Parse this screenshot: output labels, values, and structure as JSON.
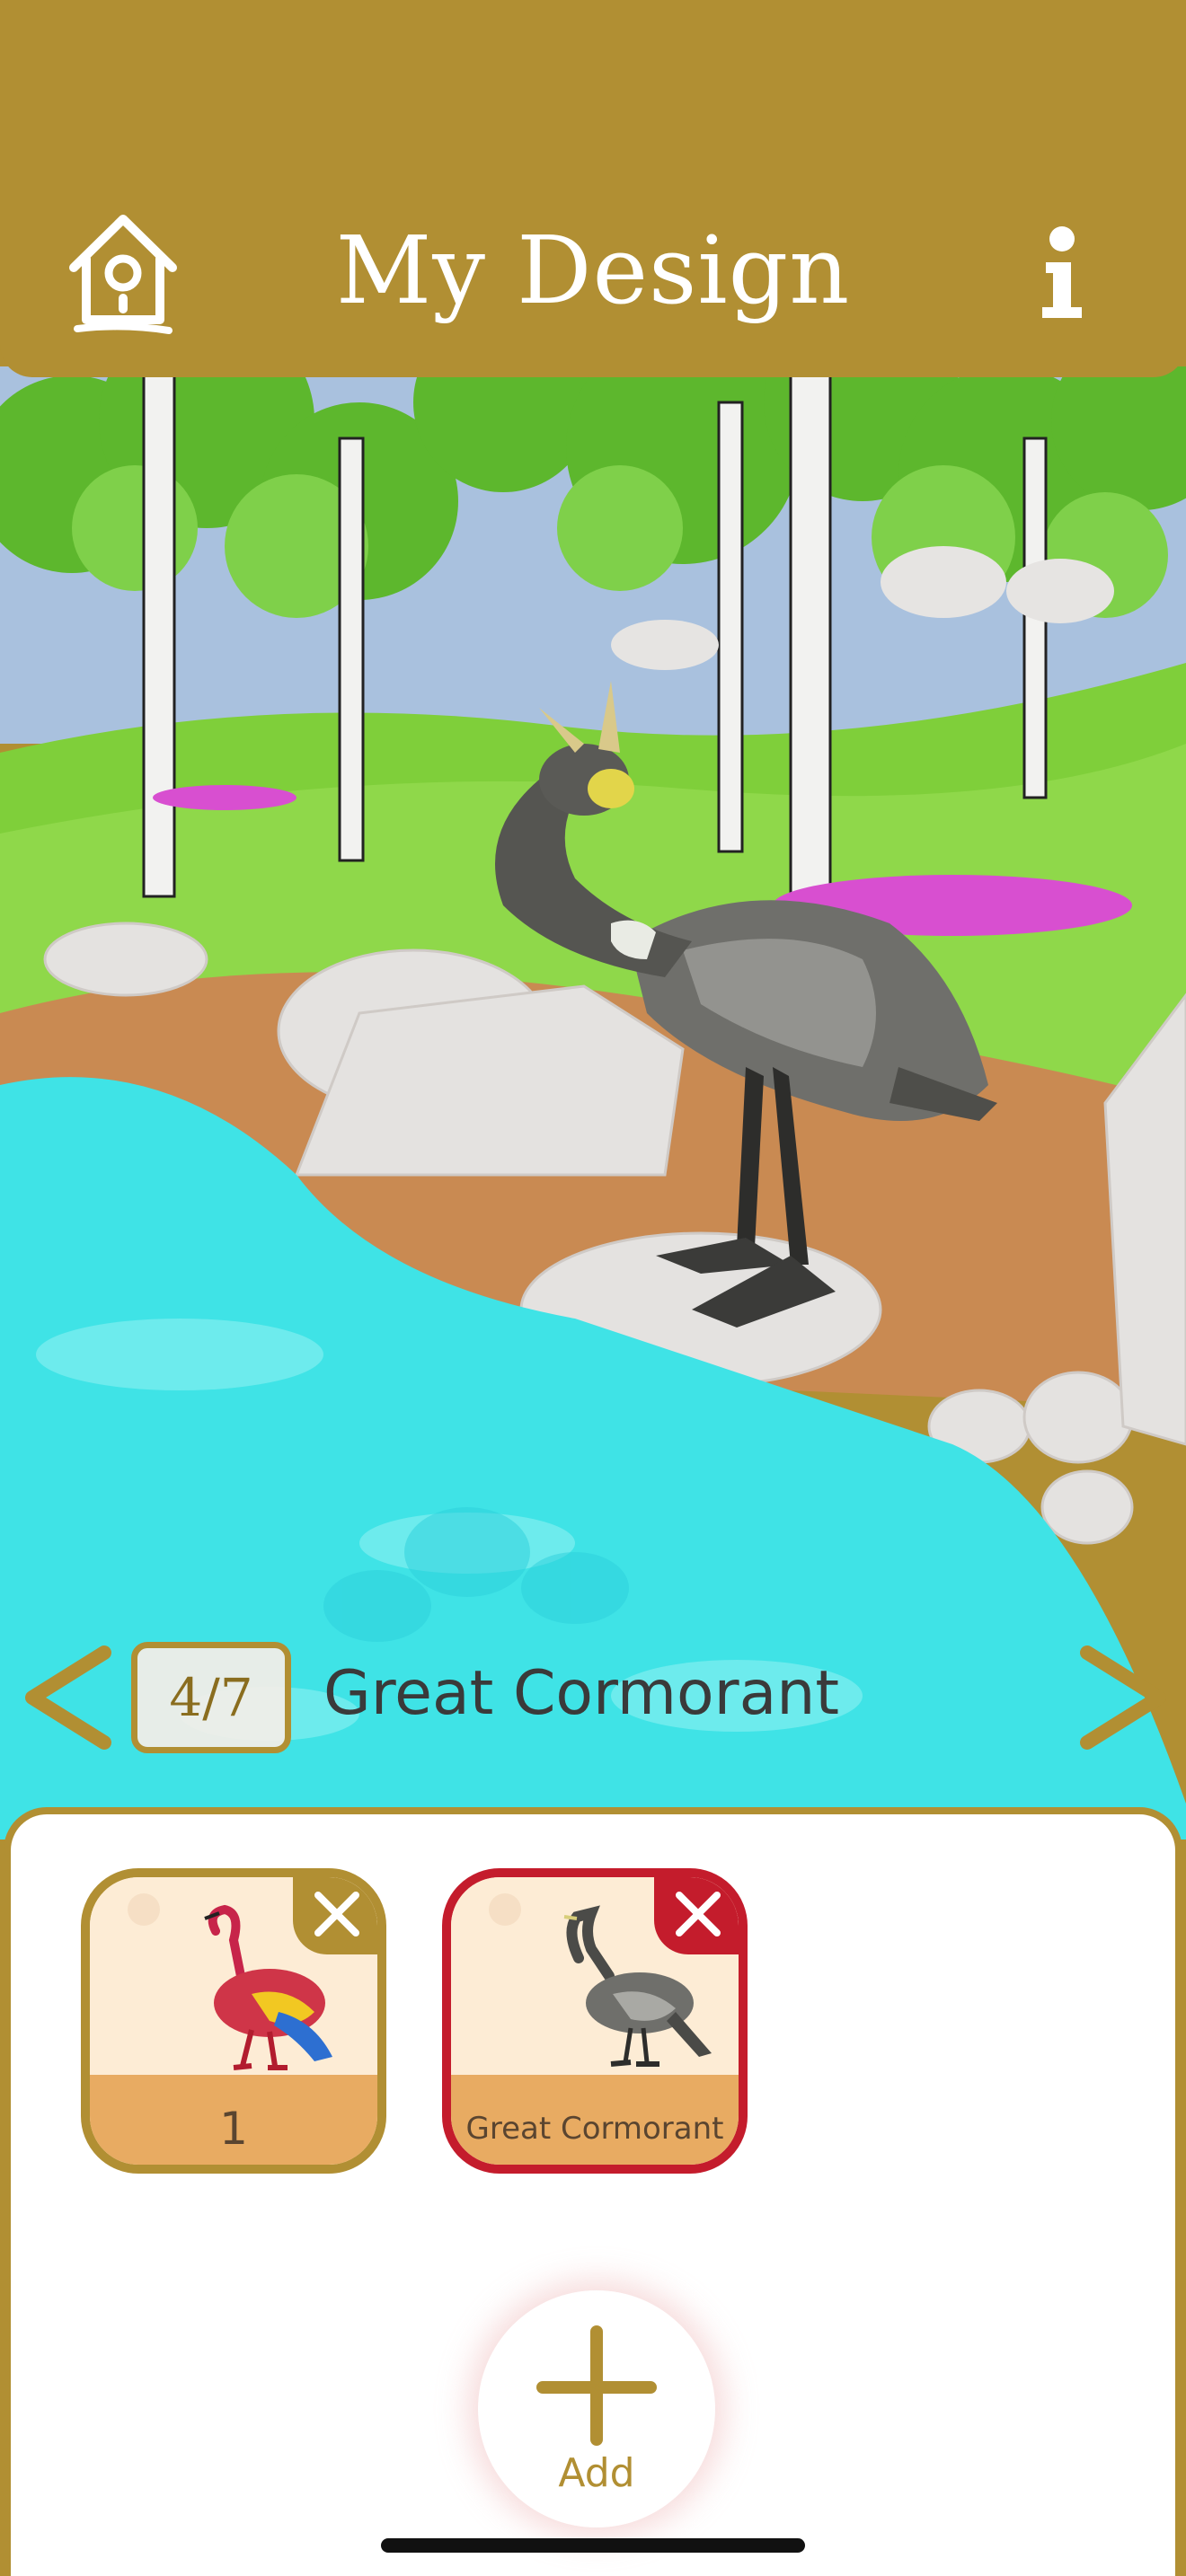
{
  "header": {
    "title": "My Design",
    "home_icon": "birdhouse-icon",
    "info_icon": "info-icon"
  },
  "selector": {
    "counter": "4/7",
    "bird_name": "Great Cormorant",
    "prev_icon": "chevron-left-icon",
    "next_icon": "chevron-right-icon"
  },
  "designs": [
    {
      "label": "1",
      "thumbnail": "flamingo-design-thumbnail",
      "selected": false
    },
    {
      "label": "Great Cormorant",
      "thumbnail": "cormorant-thumbnail",
      "selected": true
    }
  ],
  "add_button": {
    "label": "Add",
    "icon": "plus-icon"
  },
  "colors": {
    "header": "#b18f33",
    "accent_gold": "#b18f33",
    "selected_red": "#c41c2c",
    "card_band": "#e8ab62"
  }
}
